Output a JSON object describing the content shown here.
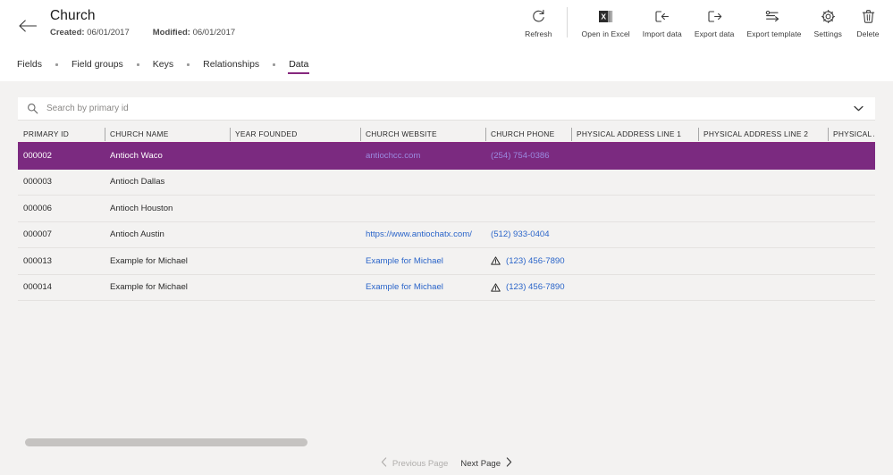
{
  "header": {
    "back_icon": "arrow-left-icon",
    "title": "Church",
    "created_label": "Created:",
    "created_value": "06/01/2017",
    "modified_label": "Modified:",
    "modified_value": "06/01/2017"
  },
  "toolbar": {
    "items": [
      {
        "icon": "refresh-icon",
        "label": "Refresh",
        "name": "refresh"
      },
      {
        "icon": "excel-icon",
        "label": "Open in Excel",
        "name": "open-in-excel"
      },
      {
        "icon": "import-icon",
        "label": "Import data",
        "name": "import-data"
      },
      {
        "icon": "export-icon",
        "label": "Export data",
        "name": "export-data"
      },
      {
        "icon": "export-template-icon",
        "label": "Export template",
        "name": "export-template"
      },
      {
        "icon": "gear-icon",
        "label": "Settings",
        "name": "settings"
      },
      {
        "icon": "trash-icon",
        "label": "Delete",
        "name": "delete"
      }
    ]
  },
  "tabs": {
    "items": [
      {
        "label": "Fields",
        "active": false
      },
      {
        "label": "Field groups",
        "active": false
      },
      {
        "label": "Keys",
        "active": false
      },
      {
        "label": "Relationships",
        "active": false
      },
      {
        "label": "Data",
        "active": true
      }
    ]
  },
  "search": {
    "icon": "search-icon",
    "placeholder": "Search by primary id",
    "value": "",
    "chevron_icon": "chevron-down-icon"
  },
  "grid": {
    "columns": [
      "PRIMARY ID",
      "CHURCH NAME",
      "YEAR FOUNDED",
      "CHURCH WEBSITE",
      "CHURCH PHONE",
      "PHYSICAL ADDRESS LINE 1",
      "PHYSICAL ADDRESS LINE 2",
      "PHYSICAL A"
    ],
    "rows": [
      {
        "selected": true,
        "primary_id": "000002",
        "church_name": "Antioch Waco",
        "year_founded": "",
        "church_website": "antiochcc.com",
        "website_is_link": true,
        "church_phone": "(254) 754-0386",
        "phone_is_link": true,
        "phone_warning": false,
        "address_line_1": "",
        "address_line_2": "",
        "address_extra": ""
      },
      {
        "selected": false,
        "primary_id": "000003",
        "church_name": "Antioch Dallas",
        "year_founded": "",
        "church_website": "",
        "website_is_link": false,
        "church_phone": "",
        "phone_is_link": false,
        "phone_warning": false,
        "address_line_1": "",
        "address_line_2": "",
        "address_extra": ""
      },
      {
        "selected": false,
        "primary_id": "000006",
        "church_name": "Antioch Houston",
        "year_founded": "",
        "church_website": "",
        "website_is_link": false,
        "church_phone": "",
        "phone_is_link": false,
        "phone_warning": false,
        "address_line_1": "",
        "address_line_2": "",
        "address_extra": ""
      },
      {
        "selected": false,
        "primary_id": "000007",
        "church_name": "Antioch Austin",
        "year_founded": "",
        "church_website": "https://www.antiochatx.com/",
        "website_is_link": true,
        "church_phone": "(512) 933-0404",
        "phone_is_link": true,
        "phone_warning": false,
        "address_line_1": "",
        "address_line_2": "",
        "address_extra": ""
      },
      {
        "selected": false,
        "primary_id": "000013",
        "church_name": "Example for Michael",
        "year_founded": "",
        "church_website": "Example for Michael",
        "website_is_link": true,
        "church_phone": "(123) 456-7890",
        "phone_is_link": true,
        "phone_warning": true,
        "address_line_1": "",
        "address_line_2": "",
        "address_extra": ""
      },
      {
        "selected": false,
        "primary_id": "000014",
        "church_name": "Example for Michael",
        "year_founded": "",
        "church_website": "Example for Michael",
        "website_is_link": true,
        "church_phone": "(123) 456-7890",
        "phone_is_link": true,
        "phone_warning": true,
        "address_line_1": "",
        "address_line_2": "",
        "address_extra": ""
      }
    ],
    "warning_icon": "warning-triangle-icon"
  },
  "pagination": {
    "previous_label": "Previous Page",
    "next_label": "Next Page",
    "previous_enabled": false,
    "next_enabled": true,
    "prev_icon": "chevron-left-icon",
    "next_icon": "chevron-right-icon"
  },
  "colors": {
    "accent": "#86287e",
    "selected_row": "#7b2a80",
    "link": "#2b65c9",
    "page_bg": "#f3f2f1"
  }
}
